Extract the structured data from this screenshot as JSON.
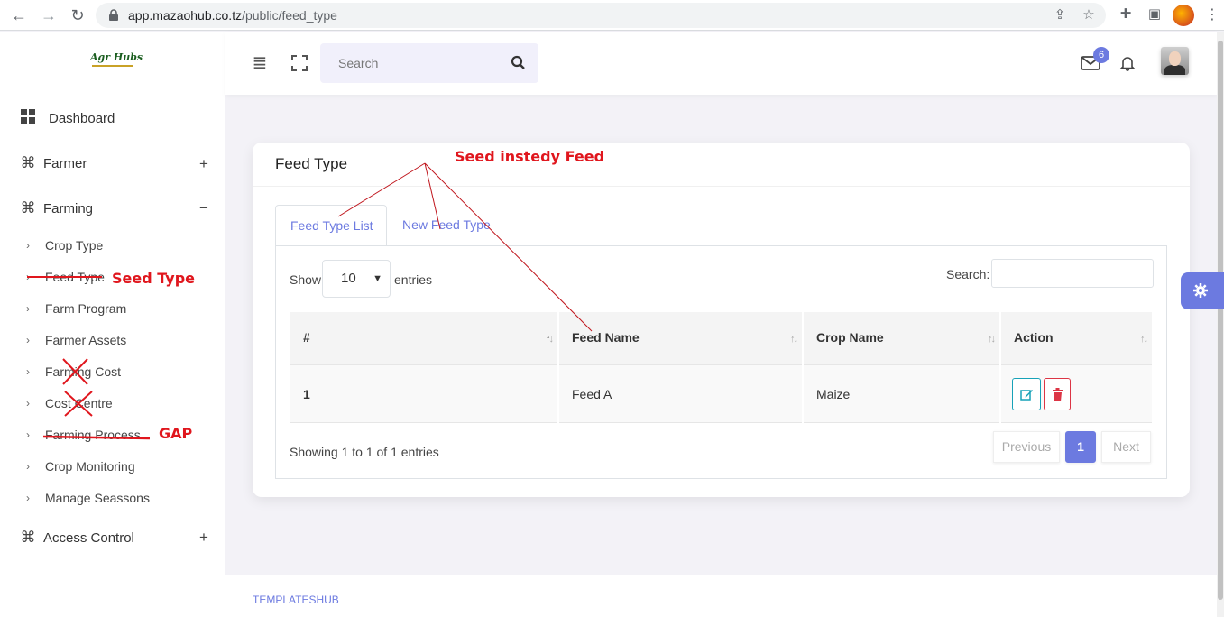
{
  "browser": {
    "url_host": "app.mazaohub.co.tz",
    "url_path": "/public/feed_type"
  },
  "brand": {
    "logo_text": "Agr Hubs",
    "accent_color": "#6c7ae0"
  },
  "sidebar": {
    "dashboard": "Dashboard",
    "farmer": "Farmer",
    "farming": "Farming",
    "farming_items": [
      "Crop Type",
      "Feed Type",
      "Farm Program",
      "Farmer Assets",
      "Farming Cost",
      "Cost Centre",
      "Farming Process",
      "Crop Monitoring",
      "Manage Seassons"
    ],
    "access_control": "Access Control",
    "plus": "+",
    "minus": "−"
  },
  "header": {
    "search_placeholder": "Search",
    "mail_count": "6"
  },
  "card": {
    "title": "Feed Type",
    "tabs": [
      "Feed Type List",
      "New Feed Type"
    ],
    "show_label": "Show",
    "page_length": "10",
    "entries_label": "entries",
    "search_label": "Search:",
    "columns": [
      "#",
      "Feed Name",
      "Crop Name",
      "Action"
    ],
    "rows": [
      {
        "id": "1",
        "feed_name": "Feed A",
        "crop_name": "Maize"
      }
    ],
    "info": "Showing 1 to 1 of 1 entries",
    "pagination": {
      "previous": "Previous",
      "current": "1",
      "next": "Next"
    }
  },
  "footer": {
    "link": "TEMPLATESHUB"
  },
  "annotations": {
    "title_note": "Seed instedy Feed",
    "sidebar_note": "Seed Type",
    "gap_note": "GAP"
  }
}
